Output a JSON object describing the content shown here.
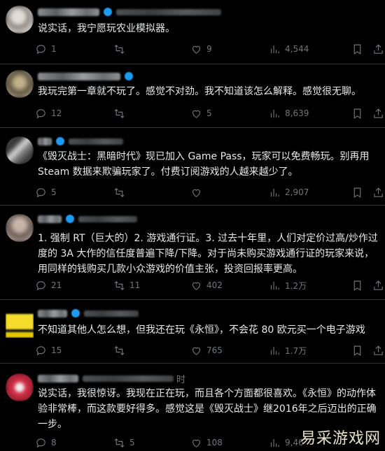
{
  "posts": [
    {
      "avatar_colors": [
        "#c9c3bf",
        "#8f8a86",
        "#e2dcd6"
      ],
      "time_suffix": "",
      "text": "说实话，我宁愿玩农业模拟器。",
      "reply_count": "1",
      "retweet_count": "",
      "like_count": "9",
      "view_count": "4,544"
    },
    {
      "avatar_colors": [
        "#9a8e72",
        "#5e5544",
        "#c2b28a"
      ],
      "time_suffix": "",
      "text": "我玩完第一章就不玩了。感觉不对劲。我不知道该怎么解释。感觉很无聊。",
      "reply_count": "12",
      "retweet_count": "",
      "like_count": "5",
      "view_count": "8,639"
    },
    {
      "avatar_colors": [
        "#7b7b7b",
        "#d8d8d8",
        "#3a3a3a"
      ],
      "time_suffix": "",
      "text": "《毁灭战士：黑暗时代》现已加入 Game Pass，玩家可以免费畅玩。别再用 Steam 数据来欺骗玩家了。付费订阅游戏的人越来越少了。",
      "reply_count": "5",
      "retweet_count": "",
      "like_count": "",
      "view_count": "2,907"
    },
    {
      "avatar_colors": [
        "#a08f86",
        "#6b5d57",
        "#c7b5aa"
      ],
      "time_suffix": "",
      "text": "1. 强制 RT（巨大的）2. 游戏通行证。3. 过去十年里，人们对定价过高/炒作过度的 3A 大作的信任度普遍下降/下降。对于尚未购买游戏通行证的玩家来说，用同样的钱购买几款小众游戏的价值主张，投资回报率更高。",
      "reply_count": "21",
      "retweet_count": "11",
      "like_count": "402",
      "view_count": "1.2万"
    },
    {
      "avatar_colors": [
        "#e3c700",
        "#1a1a1a",
        "#f4dc2a"
      ],
      "time_suffix": "",
      "text": "不知道其他人怎么想，但我还在玩《永恒》，不会花 80 欧元买一个电子游戏",
      "reply_count": "15",
      "retweet_count": "",
      "like_count": "765",
      "view_count": "1.7万"
    },
    {
      "avatar_colors": [
        "#d8324a",
        "#f0f0f0",
        "#a11f33"
      ],
      "time_suffix": "时",
      "text": "说实话，我很惊讶。我现在正在玩，而且各个方面都很喜欢。《永恒》的动作体验非常棒，而这款要好得多。感觉这是《毁灭战士》继2016年之后迈出的正确一步。",
      "reply_count": "8",
      "retweet_count": "5",
      "like_count": "108",
      "view_count": "9,46"
    }
  ],
  "icons": {
    "reply": "reply-icon",
    "retweet": "retweet-icon",
    "like": "heart-icon",
    "views": "views-icon",
    "bookmark": "bookmark-icon",
    "share": "share-icon"
  },
  "watermark": "易采游戏网"
}
